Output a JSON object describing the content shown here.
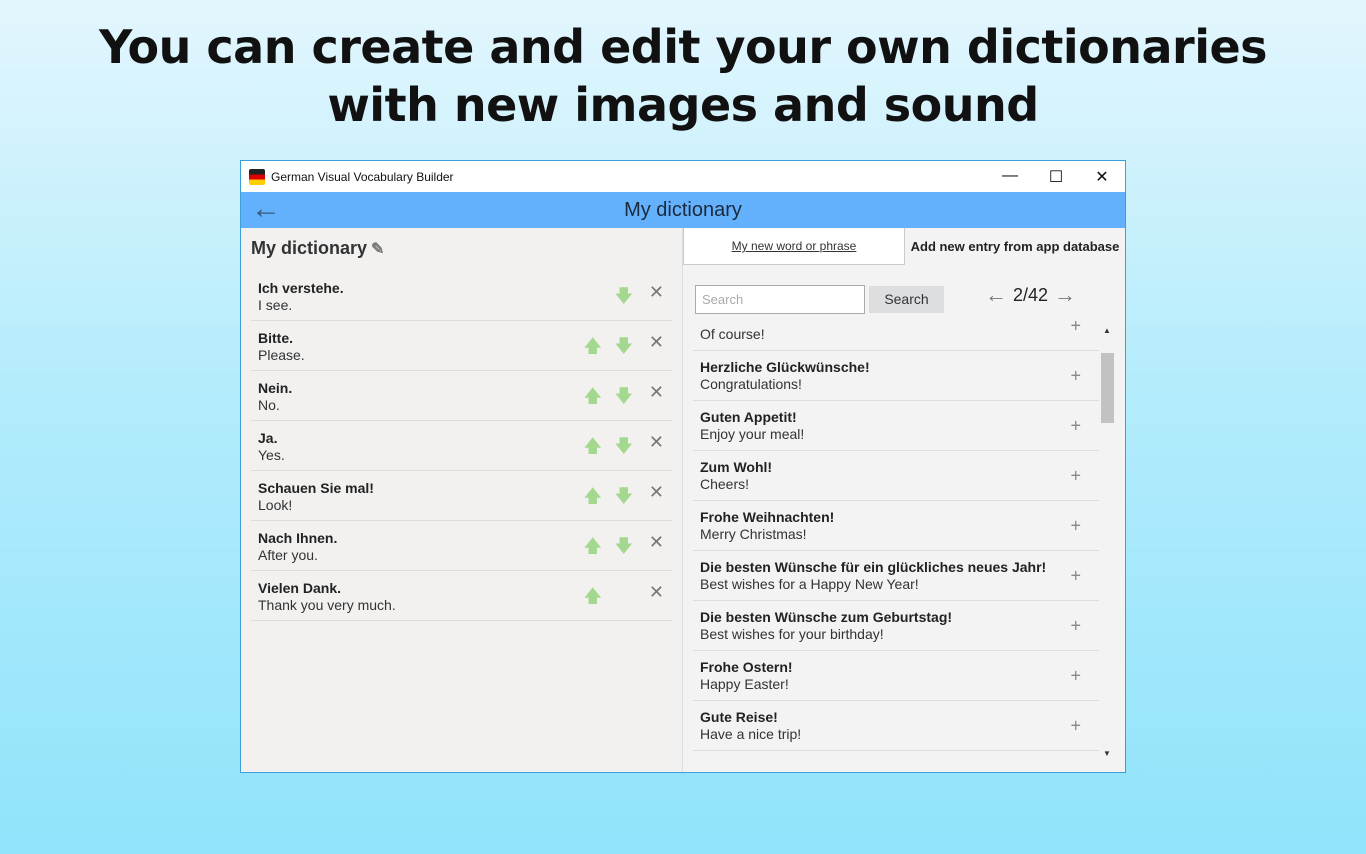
{
  "headline": {
    "line1": "You can create and edit your own dictionaries",
    "line2": "with new images and sound"
  },
  "window": {
    "title": "German Visual Vocabulary Builder",
    "minimize": "—",
    "maximize": "☐",
    "close": "✕"
  },
  "appbar": {
    "title": "My dictionary",
    "back": "←"
  },
  "left": {
    "title": "My dictionary",
    "edit_icon": "✎",
    "entries": [
      {
        "de": "Ich verstehe.",
        "en": "I see."
      },
      {
        "de": "Bitte.",
        "en": "Please."
      },
      {
        "de": "Nein.",
        "en": "No."
      },
      {
        "de": "Ja.",
        "en": "Yes."
      },
      {
        "de": "Schauen Sie mal!",
        "en": "Look!"
      },
      {
        "de": "Nach Ihnen.",
        "en": "After you."
      },
      {
        "de": "Vielen Dank.",
        "en": "Thank you very much."
      }
    ]
  },
  "right": {
    "tabs": [
      "My new word or phrase",
      "Add new entry from app database"
    ],
    "search_placeholder": "Search",
    "search_button": "Search",
    "page": "2/42",
    "entries": [
      {
        "de": "",
        "en": "Of course!"
      },
      {
        "de": "Herzliche Glückwünsche!",
        "en": "Congratulations!"
      },
      {
        "de": "Guten Appetit!",
        "en": "Enjoy your meal!"
      },
      {
        "de": "Zum Wohl!",
        "en": "Cheers!"
      },
      {
        "de": "Frohe Weihnachten!",
        "en": "Merry Christmas!"
      },
      {
        "de": "Die besten Wünsche für ein glückliches neues Jahr!",
        "en": "Best wishes for a Happy New Year!"
      },
      {
        "de": "Die besten Wünsche zum Geburtstag!",
        "en": "Best wishes for your birthday!"
      },
      {
        "de": "Frohe Ostern!",
        "en": "Happy Easter!"
      },
      {
        "de": "Gute Reise!",
        "en": "Have a nice trip!"
      }
    ]
  }
}
